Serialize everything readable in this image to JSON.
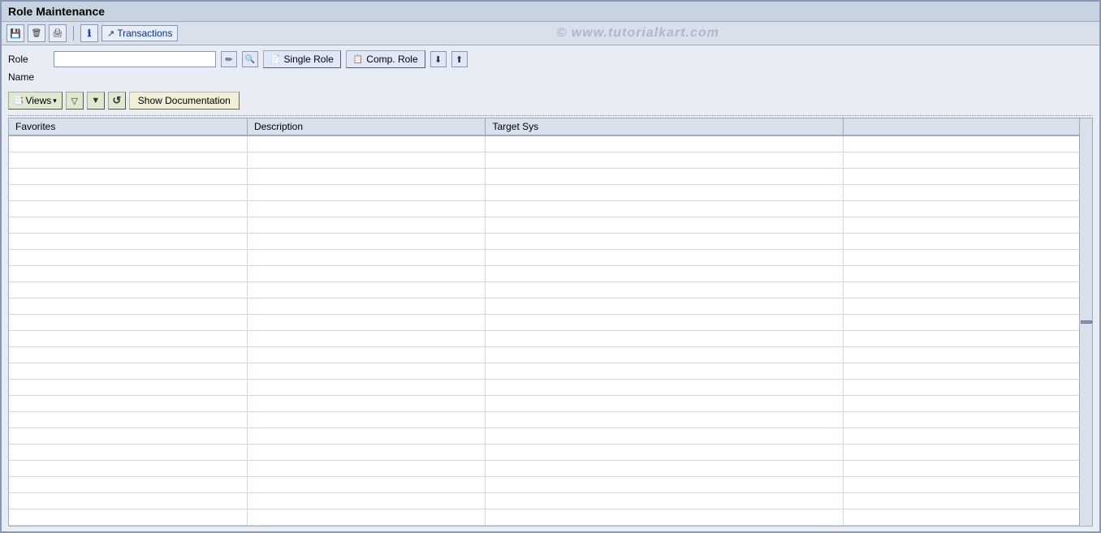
{
  "title": "Role Maintenance",
  "watermark": "© www.tutorialkart.com",
  "toolbar": {
    "buttons": [
      {
        "id": "save-btn",
        "icon": "save",
        "tooltip": "Save"
      },
      {
        "id": "delete-btn",
        "icon": "delete",
        "tooltip": "Delete"
      },
      {
        "id": "print-btn",
        "icon": "print",
        "tooltip": "Print"
      }
    ],
    "info_btn_tooltip": "Info",
    "transactions_label": "Transactions"
  },
  "role_section": {
    "role_label": "Role",
    "role_value": "",
    "role_placeholder": "",
    "name_label": "Name",
    "name_value": "",
    "btn_single_role_label": "Single Role",
    "btn_comp_role_label": "Comp. Role"
  },
  "second_toolbar": {
    "views_label": "Views",
    "show_documentation_label": "Show Documentation"
  },
  "table": {
    "columns": [
      {
        "id": "favorites",
        "label": "Favorites"
      },
      {
        "id": "description",
        "label": "Description"
      },
      {
        "id": "target_sys",
        "label": "Target Sys"
      },
      {
        "id": "extra",
        "label": ""
      }
    ],
    "rows": []
  }
}
